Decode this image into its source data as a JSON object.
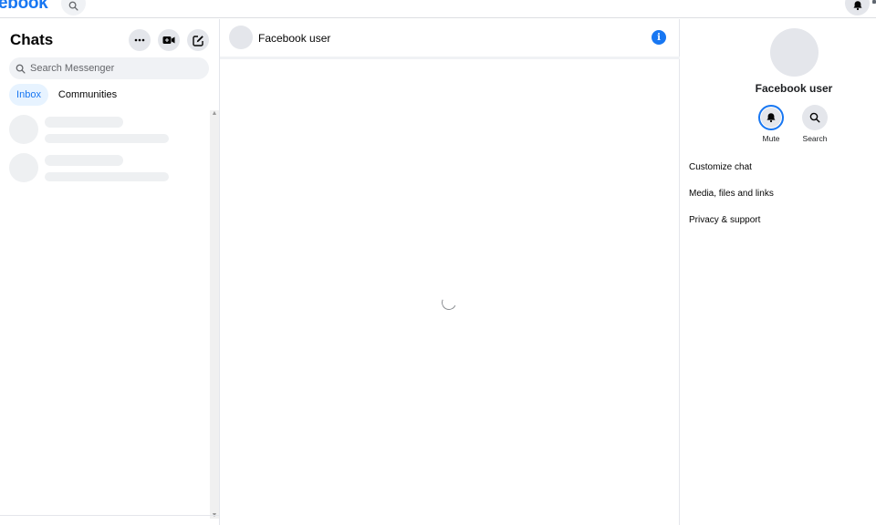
{
  "topbar": {
    "logo_text": "ebook",
    "search_icon": "search-icon",
    "notifications_icon": "bell-icon"
  },
  "sidebar": {
    "title": "Chats",
    "buttons": [
      {
        "name": "options",
        "icon": "more-dots-icon"
      },
      {
        "name": "video",
        "icon": "video-camera-icon"
      },
      {
        "name": "new-message",
        "icon": "compose-icon"
      }
    ],
    "search": {
      "placeholder": "Search Messenger",
      "value": ""
    },
    "tabs": [
      {
        "label": "Inbox",
        "active": true
      },
      {
        "label": "Communities",
        "active": false
      }
    ]
  },
  "chat": {
    "contact_name": "Facebook user",
    "info_icon": "info-icon",
    "loading": true
  },
  "profile": {
    "name": "Facebook user",
    "actions": [
      {
        "label": "Mute",
        "icon": "bell-icon",
        "active": true
      },
      {
        "label": "Search",
        "icon": "search-icon",
        "active": false
      }
    ],
    "menu": [
      {
        "label": "Customize chat"
      },
      {
        "label": "Media, files and links"
      },
      {
        "label": "Privacy & support"
      }
    ]
  },
  "colors": {
    "accent": "#1877f2",
    "skeleton": "#eef0f2",
    "button_bg": "#e4e6eb",
    "search_bg": "#f0f2f5"
  }
}
